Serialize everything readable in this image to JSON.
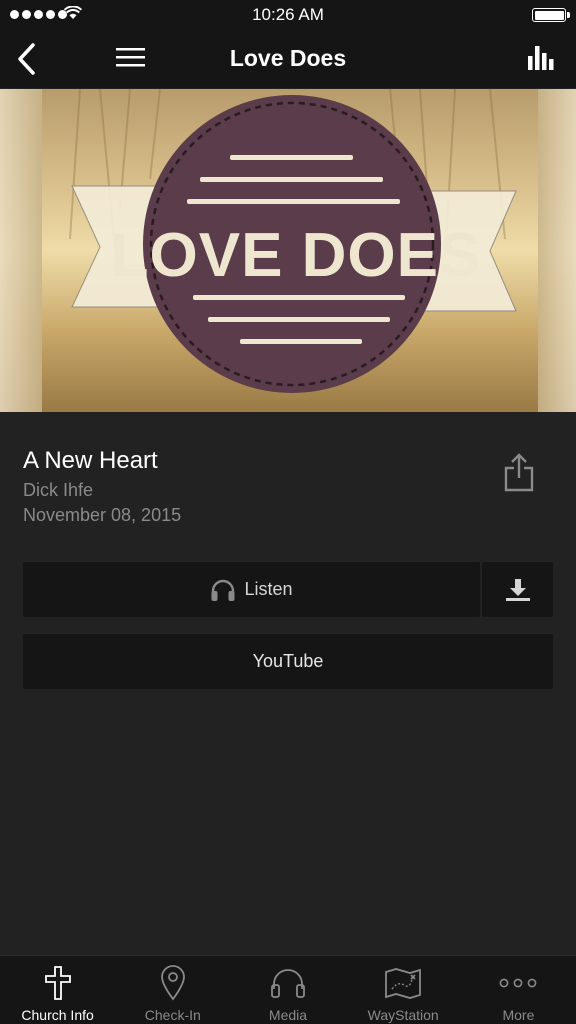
{
  "status_bar": {
    "time": "10:26 AM"
  },
  "nav": {
    "title": "Love Does"
  },
  "banner": {
    "text": "LOVE DOES",
    "colors": {
      "badge": "#5a3c4a",
      "stripe": "#efe6cf"
    }
  },
  "sermon": {
    "title": "A New Heart",
    "speaker": "Dick Ihfe",
    "date": "November 08, 2015"
  },
  "actions": {
    "listen_label": "Listen",
    "youtube_label": "YouTube"
  },
  "tabs": [
    {
      "label": "Church Info",
      "icon": "cross-icon",
      "active": true
    },
    {
      "label": "Check-In",
      "icon": "location-pin-icon",
      "active": false
    },
    {
      "label": "Media",
      "icon": "headphones-icon",
      "active": false
    },
    {
      "label": "WayStation",
      "icon": "map-icon",
      "active": false
    },
    {
      "label": "More",
      "icon": "more-dots-icon",
      "active": false
    }
  ],
  "colors": {
    "background": "#222222",
    "bar": "#151515",
    "secondary_text": "#8a8a8a"
  }
}
